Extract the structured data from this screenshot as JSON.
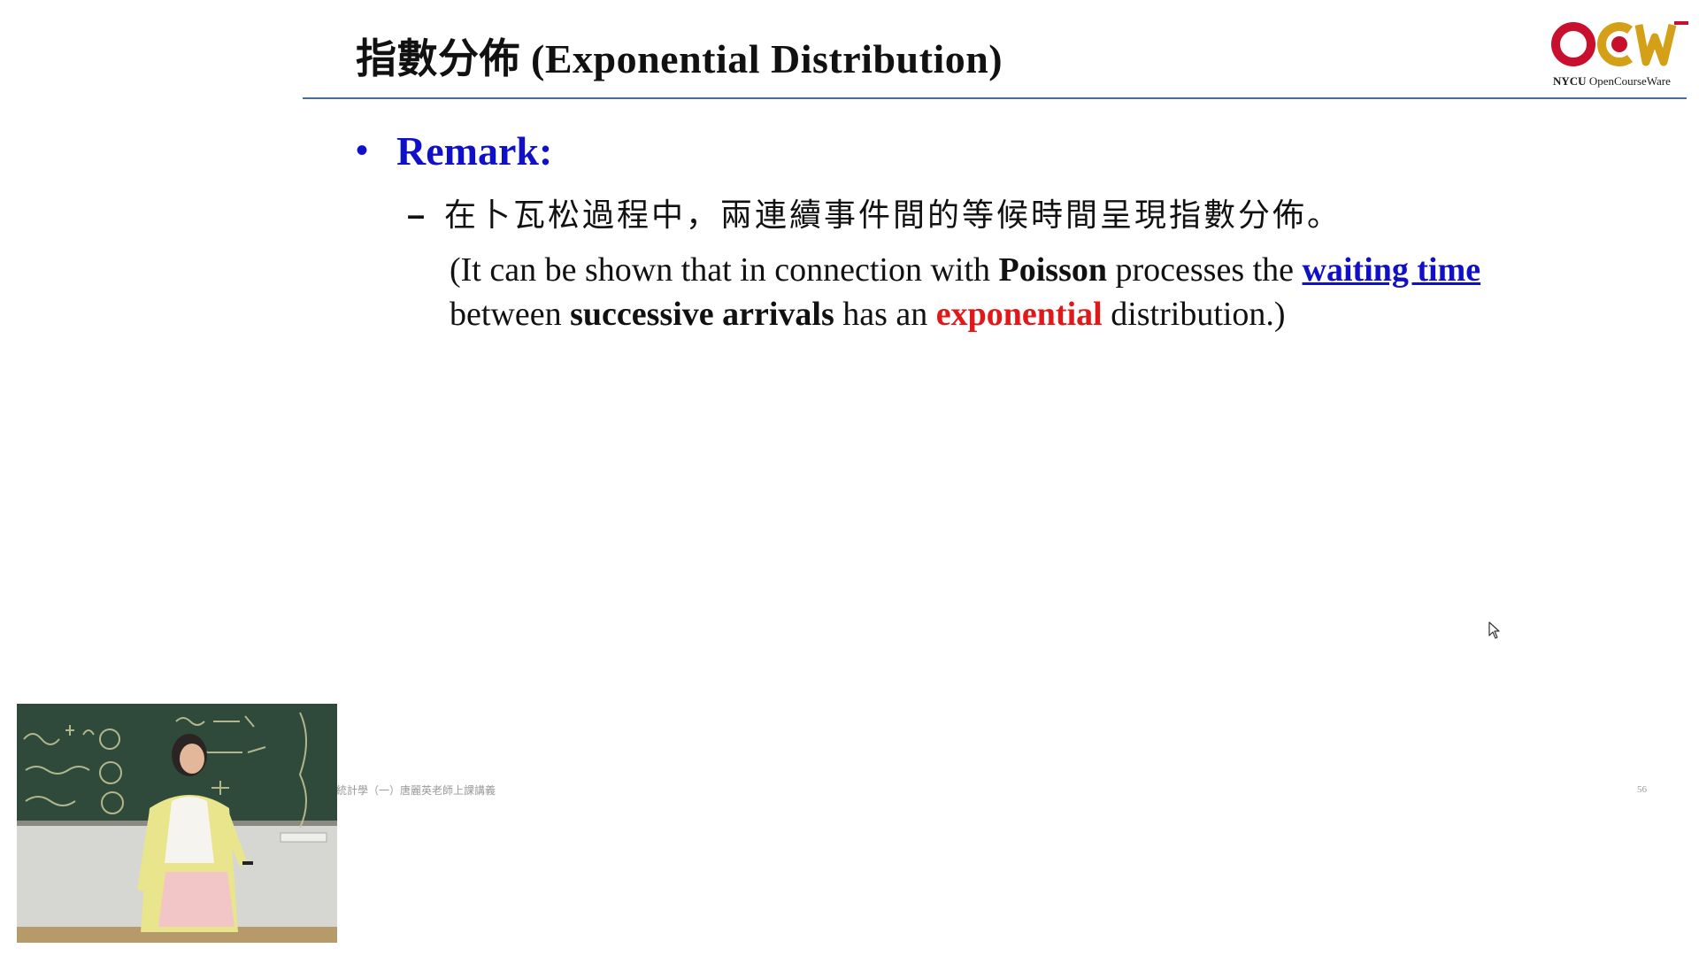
{
  "slide": {
    "title": "指數分佈 (Exponential Distribution)",
    "logo": {
      "mark": "OCW",
      "brand": "NYCU",
      "name": "OpenCourseWare",
      "colors": {
        "red": "#c8102e",
        "gold": "#d4a017"
      }
    },
    "bullet": {
      "marker": "•",
      "heading": "Remark:"
    },
    "sub_bullet": {
      "marker": "–",
      "text": "在卜瓦松過程中，兩連續事件間的等候時間呈現指數分佈。"
    },
    "paragraph": {
      "p1": "(It can be shown that in connection with ",
      "poisson": "Poisson",
      "p2": " processes  the ",
      "waiting_time": "waiting time",
      "p3": " between ",
      "successive_arrivals": "successive arrivals",
      "p4": " has an ",
      "exponential": "exponential",
      "p5": " distribution.)"
    },
    "footer": "統計學（一）唐麗英老師上課講義",
    "page_number": "56"
  },
  "colors": {
    "heading_blue": "#1010c8",
    "emphasis_red": "#e01818",
    "rule": "#4a6d98"
  },
  "video_overlay": {
    "icon": "lecturer-video-feed"
  }
}
